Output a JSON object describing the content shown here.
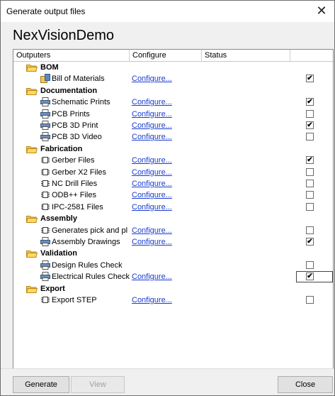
{
  "window": {
    "title": "Generate output files",
    "close_glyph": "✕"
  },
  "project_name": "NexVisionDemo",
  "columns": {
    "outputers": "Outputers",
    "configure": "Configure",
    "status": "Status"
  },
  "groups": [
    {
      "label": "BOM",
      "icon": "folder-open-icon",
      "items": [
        {
          "label": "Bill of Materials",
          "configure": "Configure...",
          "checked": true,
          "icon": "bom-report-icon"
        }
      ]
    },
    {
      "label": "Documentation",
      "icon": "folder-open-icon",
      "items": [
        {
          "label": "Schematic Prints",
          "configure": "Configure...",
          "checked": true,
          "icon": "printer-icon"
        },
        {
          "label": "PCB Prints",
          "configure": "Configure...",
          "checked": false,
          "icon": "printer-icon"
        },
        {
          "label": "PCB 3D Print",
          "configure": "Configure...",
          "checked": true,
          "icon": "printer-icon"
        },
        {
          "label": "PCB 3D Video",
          "configure": "Configure...",
          "checked": false,
          "icon": "printer-icon"
        }
      ]
    },
    {
      "label": "Fabrication",
      "icon": "folder-open-icon",
      "items": [
        {
          "label": "Gerber Files",
          "configure": "Configure...",
          "checked": true,
          "icon": "chip-icon"
        },
        {
          "label": "Gerber X2 Files",
          "configure": "Configure...",
          "checked": false,
          "icon": "chip-icon"
        },
        {
          "label": "NC Drill Files",
          "configure": "Configure...",
          "checked": false,
          "icon": "chip-icon"
        },
        {
          "label": "ODB++ Files",
          "configure": "Configure...",
          "checked": false,
          "icon": "chip-icon"
        },
        {
          "label": "IPC-2581 Files",
          "configure": "Configure...",
          "checked": false,
          "icon": "chip-icon"
        }
      ]
    },
    {
      "label": "Assembly",
      "icon": "folder-open-icon",
      "items": [
        {
          "label": "Generates pick and pl",
          "configure": "Configure...",
          "checked": false,
          "icon": "chip-icon"
        },
        {
          "label": "Assembly Drawings",
          "configure": "Configure...",
          "checked": true,
          "icon": "printer-icon"
        }
      ]
    },
    {
      "label": "Validation",
      "icon": "folder-open-icon",
      "items": [
        {
          "label": "Design Rules Check",
          "configure": "",
          "checked": false,
          "icon": "printer-icon"
        },
        {
          "label": "Electrical Rules Check",
          "configure": "Configure...",
          "checked": true,
          "icon": "printer-icon",
          "focused": true
        }
      ]
    },
    {
      "label": "Export",
      "icon": "folder-open-icon",
      "items": [
        {
          "label": "Export STEP",
          "configure": "Configure...",
          "checked": false,
          "icon": "chip-icon"
        }
      ]
    }
  ],
  "buttons": {
    "generate": "Generate",
    "view": "View",
    "close": "Close"
  },
  "check_glyph": "✔"
}
